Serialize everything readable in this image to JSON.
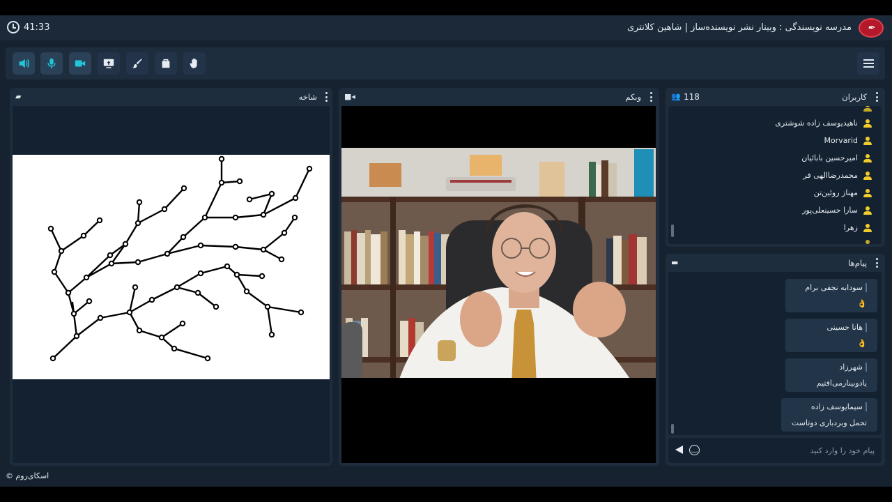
{
  "header": {
    "timer": "41:33",
    "title": "مدرسه نویسندگی : وبینار نشر نویسنده‌ساز | شاهین کلانتری"
  },
  "toolbar": {
    "tools": [
      "speaker-icon",
      "microphone-icon",
      "camera-icon",
      "screen-share-icon",
      "brush-icon",
      "files-icon",
      "raise-hand-icon"
    ]
  },
  "whiteboard": {
    "title": "شاخه"
  },
  "webcam": {
    "title": "وبکم"
  },
  "users": {
    "title": "کاربران",
    "count": "118",
    "items": [
      {
        "name": "ناهیدیوسف زاده شوشتری"
      },
      {
        "name": "Morvarid"
      },
      {
        "name": "امیرحسین بابائیان"
      },
      {
        "name": "محمدرضاالهی فر"
      },
      {
        "name": "مهناز روئین‌تن"
      },
      {
        "name": "سارا حسینعلی‌پور"
      },
      {
        "name": "زهرا"
      }
    ]
  },
  "chat": {
    "title": "پیام‌ها",
    "messages": [
      {
        "name": "سودابه نجفی برام",
        "text": "👌"
      },
      {
        "name": "هانا حسینی",
        "text": "👌"
      },
      {
        "name": "شهرزاد",
        "text": "یادوبینارمی‌افتیم"
      },
      {
        "name": "سیمایوسف زاده",
        "text": "تحمل وبردباری دوتاست"
      }
    ],
    "input_placeholder": "پیام خود را وارد کنید"
  },
  "footer": {
    "brand": "اسکای‌روم ©"
  },
  "colors": {
    "accent": "#22c6d9",
    "user_icon": "#f2cc2b",
    "logo": "#b3182b"
  }
}
